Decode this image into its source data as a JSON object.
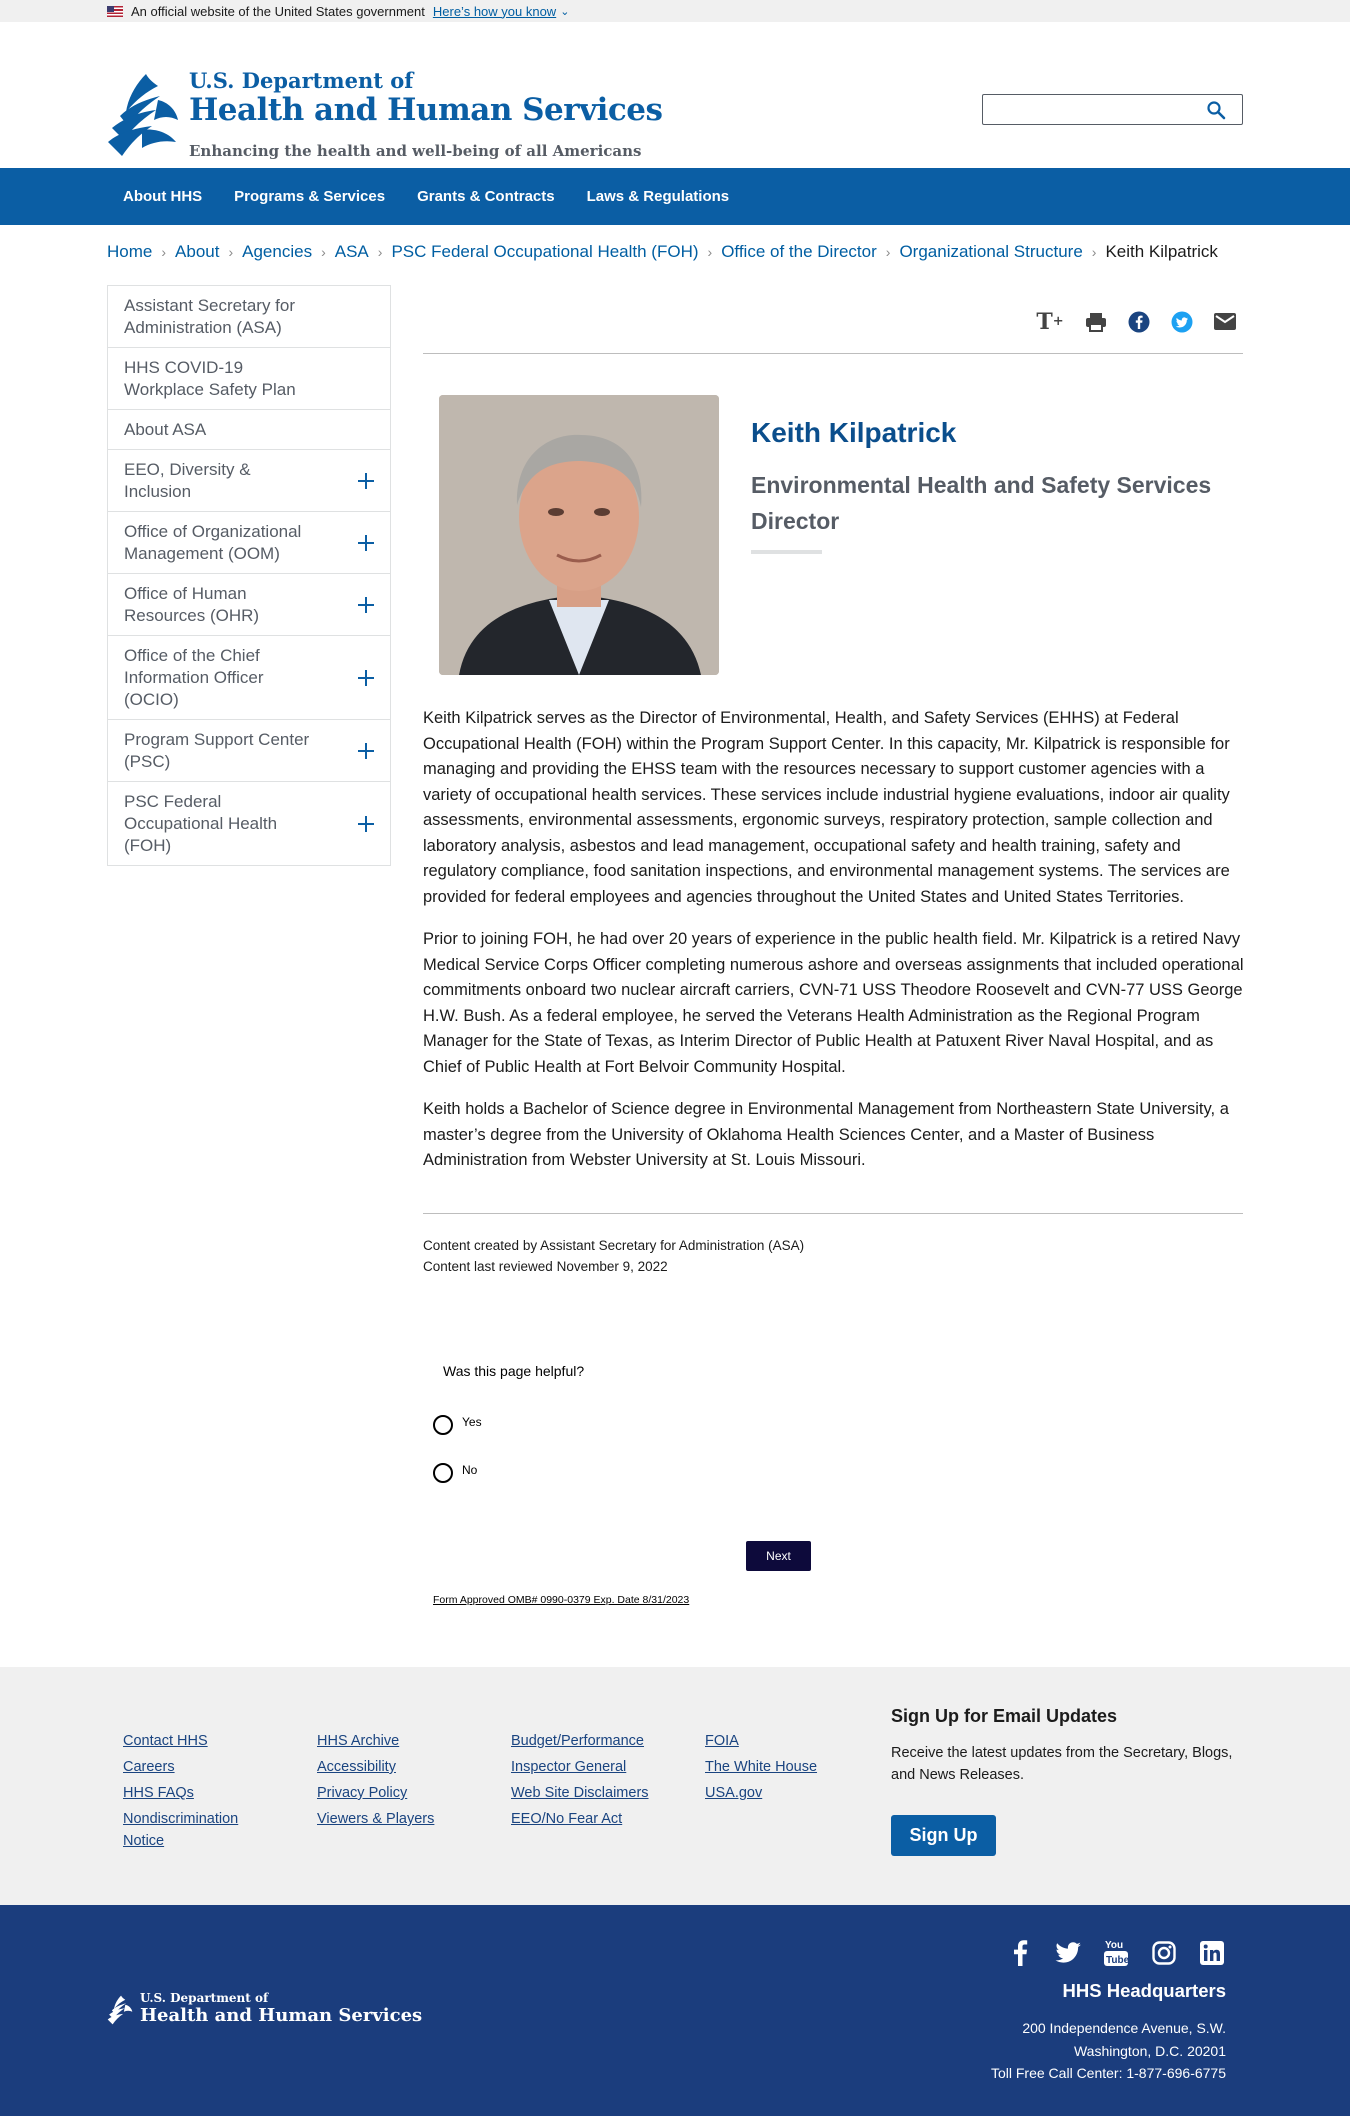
{
  "gov_banner": {
    "text": "An official website of the United States government",
    "link": "Here’s how you know"
  },
  "header": {
    "dept": "U.S. Department of",
    "name": "Health and Human Services",
    "tagline": "Enhancing the health and well-being of all Americans",
    "search_placeholder": ""
  },
  "nav": [
    "About HHS",
    "Programs & Services",
    "Grants & Contracts",
    "Laws & Regulations"
  ],
  "breadcrumb": {
    "items": [
      "Home",
      "About",
      "Agencies",
      "ASA",
      "PSC Federal Occupational Health (FOH)",
      "Office of the Director",
      "Organizational Structure"
    ],
    "current": "Keith Kilpatrick"
  },
  "sidenav": [
    {
      "label": "Assistant Secretary for Administration (ASA)",
      "expandable": false
    },
    {
      "label": "HHS COVID-19 Workplace Safety Plan",
      "expandable": false
    },
    {
      "label": "About ASA",
      "expandable": false
    },
    {
      "label": "EEO, Diversity & Inclusion",
      "expandable": true
    },
    {
      "label": "Office of Organizational Management (OOM)",
      "expandable": true
    },
    {
      "label": "Office of Human Resources (OHR)",
      "expandable": true
    },
    {
      "label": "Office of the Chief Information Officer (OCIO)",
      "expandable": true
    },
    {
      "label": "Program Support Center (PSC)",
      "expandable": true
    },
    {
      "label": "PSC Federal Occupational Health (FOH)",
      "expandable": true
    }
  ],
  "share": {
    "text_size": "T",
    "text_size_plus": "+",
    "icons": [
      "text-size-icon",
      "print-icon",
      "facebook-icon",
      "twitter-icon",
      "email-icon"
    ]
  },
  "profile": {
    "name": "Keith Kilpatrick",
    "title": "Environmental Health and Safety Services Director"
  },
  "bio": [
    "Keith Kilpatrick serves as the Director of Environmental, Health, and Safety Services (EHHS) at Federal Occupational Health (FOH) within the Program Support Center.  In this capacity, Mr. Kilpatrick is responsible for managing and providing the EHSS team with the resources necessary to support customer agencies with a variety of occupational health services. These services include industrial hygiene evaluations, indoor air quality assessments, environmental assessments, ergonomic surveys, respiratory protection, sample collection and laboratory analysis, asbestos and lead management, occupational safety and health training, safety and regulatory compliance, food sanitation inspections, and environmental management systems. The services are provided for federal employees and agencies throughout the United States and United States Territories.",
    "Prior to joining FOH, he had over 20 years of experience in the public health field. Mr. Kilpatrick is a retired Navy Medical Service Corps Officer completing numerous ashore and overseas assignments that included operational commitments onboard two nuclear aircraft carriers, CVN-71 USS Theodore Roosevelt and CVN-77 USS George H.W. Bush. As a federal employee, he served the Veterans Health Administration as the Regional Program Manager for the State of Texas, as Interim Director of Public Health at Patuxent River Naval Hospital, and as Chief of Public Health at Fort Belvoir Community Hospital.",
    "Keith holds a Bachelor of Science degree in Environmental Management from Northeastern State University, a master’s degree from the University of Oklahoma Health Sciences Center, and a Master of Business Administration from Webster University at St. Louis Missouri."
  ],
  "meta": {
    "created": "Content created by Assistant Secretary for Administration (ASA)",
    "reviewed": "Content last reviewed November 9, 2022"
  },
  "survey": {
    "question": "Was this page helpful?",
    "options": [
      "Yes",
      "No"
    ],
    "next": "Next",
    "omb": "Form Approved OMB# 0990-0379 Exp. Date 8/31/2023"
  },
  "footer": {
    "columns": [
      [
        "Contact HHS",
        "Careers",
        "HHS FAQs",
        "Nondiscrimination Notice"
      ],
      [
        "HHS Archive",
        "Accessibility",
        "Privacy Policy",
        "Viewers & Players"
      ],
      [
        "Budget/Performance",
        "Inspector General",
        "Web Site Disclaimers",
        "EEO/No Fear Act"
      ],
      [
        "FOIA",
        "The White House",
        "USA.gov"
      ]
    ],
    "signup_heading": "Sign Up for Email Updates",
    "signup_text": "Receive the latest updates from the Secretary, Blogs, and News Releases.",
    "signup_button": "Sign Up",
    "dept": "U.S. Department of",
    "name": "Health and Human Services",
    "social": [
      "facebook-icon",
      "twitter-icon",
      "youtube-icon",
      "instagram-icon",
      "linkedin-icon"
    ],
    "hq_heading": "HHS Headquarters",
    "address": [
      "200 Independence Avenue, S.W.",
      "Washington, D.C. 20201",
      "Toll Free Call Center: 1-877-696-6775"
    ]
  },
  "colors": {
    "primary": "#0b5ea4",
    "footer_dark": "#1b3d7d",
    "footer_light": "#f0f0f0",
    "next_button": "#0d0a3b"
  }
}
